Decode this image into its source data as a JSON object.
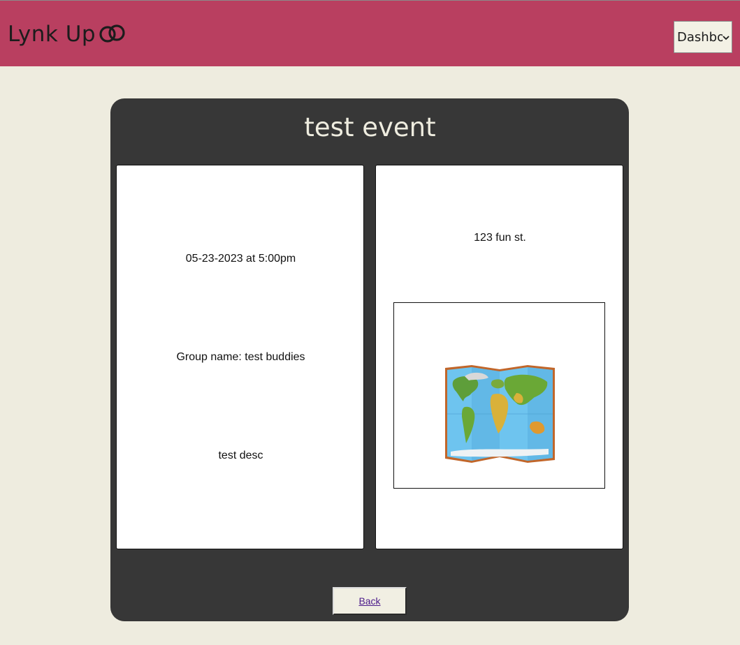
{
  "header": {
    "app_title": "Lynk Up",
    "logo_icon": "linked-rings-icon",
    "nav": {
      "selected": "Dashboard",
      "icon": "chevron-down-icon"
    }
  },
  "event": {
    "title": "test event",
    "datetime": "05-23-2023 at 5:00pm",
    "group": "Group name: test buddies",
    "description": "test desc",
    "address": "123 fun st.",
    "map_icon": "world-map-icon",
    "back_label": "Back"
  },
  "colors": {
    "header_bg": "#b93f60",
    "page_bg": "#eeecdf",
    "card_bg": "#373737",
    "panel_bg": "#ffffff"
  }
}
